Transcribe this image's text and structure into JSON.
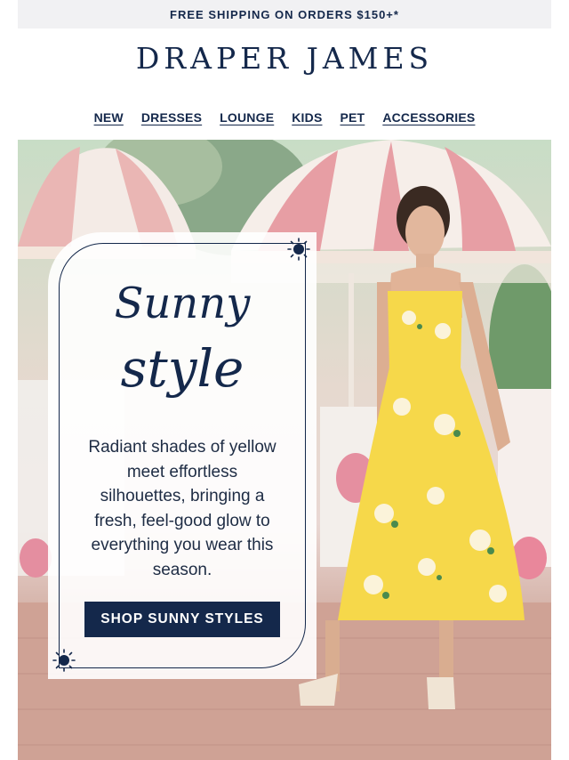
{
  "announcement": {
    "text": "FREE SHIPPING ON ORDERS $150+*"
  },
  "brand": {
    "logo": "DRAPER JAMES"
  },
  "nav": {
    "items": [
      "NEW",
      "DRESSES",
      "LOUNGE",
      "KIDS",
      "PET",
      "ACCESSORIES"
    ]
  },
  "hero": {
    "headline_line1": "Sunny",
    "headline_line2": "style",
    "body": "Radiant shades of yellow meet effortless silhouettes, bringing a fresh, feel-good glow to everything you wear this season.",
    "cta_label": "SHOP SUNNY STYLES",
    "icons": [
      "sun-icon",
      "sun-icon"
    ],
    "photo": "model-in-yellow-floral-dress"
  },
  "colors": {
    "navy": "#14284b",
    "announcement_bg": "#f1f1f3",
    "dress_yellow": "#f6d84a",
    "umbrella_pink": "#e8a0a6"
  }
}
